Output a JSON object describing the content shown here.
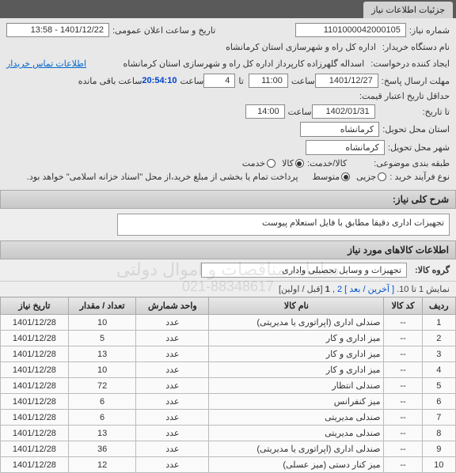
{
  "tab": {
    "title": "جزئیات اطلاعات نیاز"
  },
  "form": {
    "need_no_label": "شماره نیاز:",
    "need_no": "1101000042000105",
    "announce_label": "تاریخ و ساعت اعلان عمومی:",
    "announce_value": "1401/12/22 - 13:58",
    "buyer_label": "نام دستگاه خریدار:",
    "buyer_value": "اداره کل راه و شهرسازی استان کرمانشاه",
    "requester_label": "ایجاد کننده درخواست:",
    "requester_value": "اسداله گلهرزاده کارپرداز اداره کل راه و شهرسازی استان کرمانشاه",
    "contact_link": "اطلاعات تماس خریدار",
    "deadline_label": "مهلت ارسال پاسخ:",
    "deadline_date": "1401/12/27",
    "time_label": "ساعت",
    "deadline_time": "11:00",
    "remaining_label_pre": "تا",
    "remaining_days": "4",
    "remaining_time": "20:54:10",
    "remaining_label_post": "ساعت باقی مانده",
    "valid_label": "حداقل تاریخ اعتبار قیمت:",
    "delivery_date_label": "تا تاریخ:",
    "delivery_date": "1402/01/31",
    "delivery_time": "14:00",
    "delivery_province_label": "استان محل تحویل:",
    "delivery_city_label": "شهر محل تحویل:",
    "province": "کرمانشاه",
    "city": "کرمانشاه",
    "subject_class_label": "طبقه بندی موضوعی:",
    "good_service_label": "کالا/خدمت:",
    "opt_service": "خدمت",
    "opt_good": "کالا",
    "process_label": "نوع فرآیند خرید :",
    "opt_partial": "جزیی",
    "opt_medium": "متوسط",
    "payment_note": "پرداخت تمام یا بخشی از مبلغ خرید،از محل \"اسناد خزانه اسلامی\" خواهد بود."
  },
  "sections": {
    "desc_header": "شرح کلی نیاز:",
    "desc_text": "تجهیزات اداری دقیقا مطابق با فایل استعلام پیوست",
    "items_header": "اطلاعات کالاهای مورد نیاز",
    "group_label": "گروه کالا:",
    "group_value": "تجهیزات و وسایل تحصیلی واداری"
  },
  "pager": {
    "text_pre": "نمایش 1 تا 10.",
    "last": "[ آخرین /",
    "next": "بعد ]",
    "p2": "2",
    "sep": ",",
    "p1": "1",
    "first": "[قبل / اولین]"
  },
  "table": {
    "headers": {
      "row": "ردیف",
      "code": "کد کالا",
      "name": "نام کالا",
      "unit": "واحد شمارش",
      "qty": "تعداد / مقدار",
      "date": "تاریخ نیاز"
    },
    "rows": [
      {
        "n": "1",
        "code": "--",
        "name": "صندلی اداری (اپراتوری یا مدیریتی)",
        "unit": "عدد",
        "qty": "10",
        "date": "1401/12/28"
      },
      {
        "n": "2",
        "code": "--",
        "name": "میز اداری و کار",
        "unit": "عدد",
        "qty": "5",
        "date": "1401/12/28"
      },
      {
        "n": "3",
        "code": "--",
        "name": "میز اداری و کار",
        "unit": "عدد",
        "qty": "13",
        "date": "1401/12/28"
      },
      {
        "n": "4",
        "code": "--",
        "name": "میز اداری و کار",
        "unit": "عدد",
        "qty": "10",
        "date": "1401/12/28"
      },
      {
        "n": "5",
        "code": "--",
        "name": "صندلی انتظار",
        "unit": "عدد",
        "qty": "72",
        "date": "1401/12/28"
      },
      {
        "n": "6",
        "code": "--",
        "name": "میز کنفرانس",
        "unit": "عدد",
        "qty": "6",
        "date": "1401/12/28"
      },
      {
        "n": "7",
        "code": "--",
        "name": "صندلی مدیریتی",
        "unit": "عدد",
        "qty": "6",
        "date": "1401/12/28"
      },
      {
        "n": "8",
        "code": "--",
        "name": "صندلی مدیریتی",
        "unit": "عدد",
        "qty": "13",
        "date": "1401/12/28"
      },
      {
        "n": "9",
        "code": "--",
        "name": "صندلی اداری (اپراتوری یا مدیریتی)",
        "unit": "عدد",
        "qty": "36",
        "date": "1401/12/28"
      },
      {
        "n": "10",
        "code": "--",
        "name": "میز کنار دستی (میز عسلی)",
        "unit": "عدد",
        "qty": "12",
        "date": "1401/12/28"
      }
    ]
  },
  "overlay": {
    "line1": "سامانه مناقصات و اموال دولتی",
    "line2": "021-88348617"
  }
}
